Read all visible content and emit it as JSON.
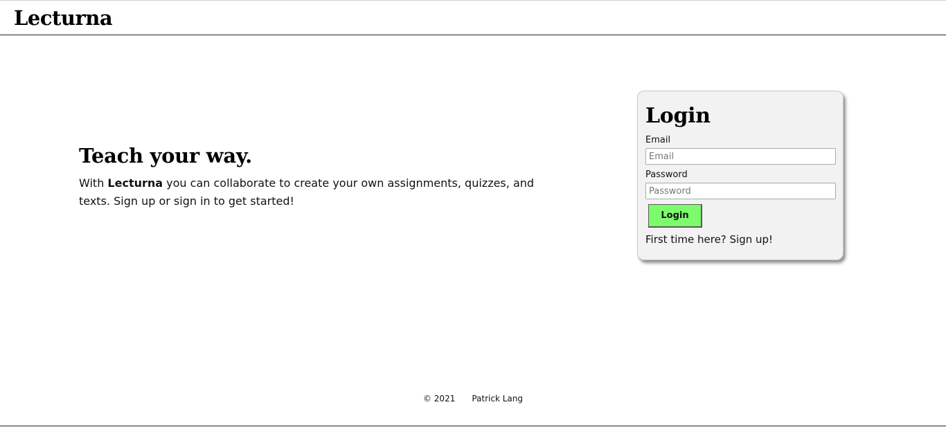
{
  "header": {
    "brand": "Lecturna"
  },
  "hero": {
    "title": "Teach your way.",
    "text_before": "With ",
    "text_brand": "Lecturna",
    "text_after": " you can collaborate to create your own assignments, quizzes, and texts. Sign up or sign in to get started!"
  },
  "login": {
    "title": "Login",
    "email_label": "Email",
    "email_placeholder": "Email",
    "password_label": "Password",
    "password_placeholder": "Password",
    "button_label": "Login",
    "signup_text": "First time here? Sign up!"
  },
  "footer": {
    "copyright": "© 2021",
    "author": "Patrick Lang"
  },
  "colors": {
    "login_button": "#7cfc6c",
    "card_background": "#f2f2f2"
  }
}
